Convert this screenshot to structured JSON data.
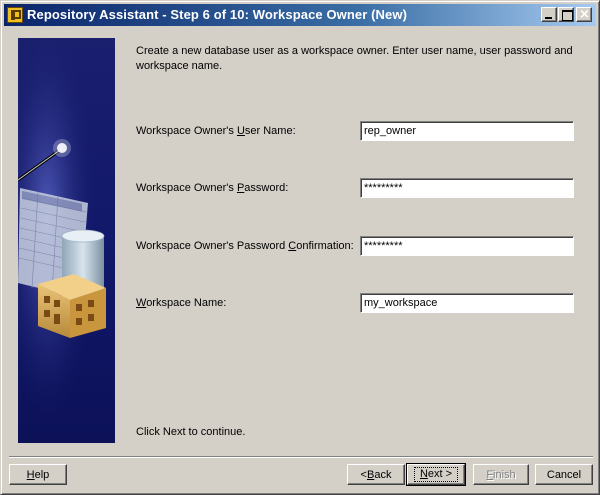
{
  "window": {
    "title": "Repository Assistant - Step 6 of 10: Workspace Owner (New)",
    "controls": {
      "minimize": "minimize",
      "maximize": "maximize",
      "close": "×"
    }
  },
  "main": {
    "intro": "Create a new database user as a workspace owner. Enter user name, user password and workspace name.",
    "fields": [
      {
        "label_pre": "Workspace Owner's ",
        "label_mnemonic": "U",
        "label_post": "ser Name:",
        "value": "rep_owner"
      },
      {
        "label_pre": "Workspace Owner's ",
        "label_mnemonic": "P",
        "label_post": "assword:",
        "value": "*********"
      },
      {
        "label_pre": "Workspace Owner's Password ",
        "label_mnemonic": "C",
        "label_post": "onfirmation:",
        "value": "*********"
      },
      {
        "label_pre": "",
        "label_mnemonic": "W",
        "label_post": "orkspace Name:",
        "value": "my_workspace"
      }
    ],
    "hint": "Click Next to continue."
  },
  "footer": {
    "help": {
      "mnemonic": "H",
      "rest": "elp"
    },
    "back": {
      "pre": "< ",
      "mnemonic": "B",
      "rest": "ack"
    },
    "next": {
      "mnemonic": "N",
      "rest": "ext >"
    },
    "finish": {
      "mnemonic": "F",
      "rest": "inish"
    },
    "cancel": "Cancel"
  }
}
